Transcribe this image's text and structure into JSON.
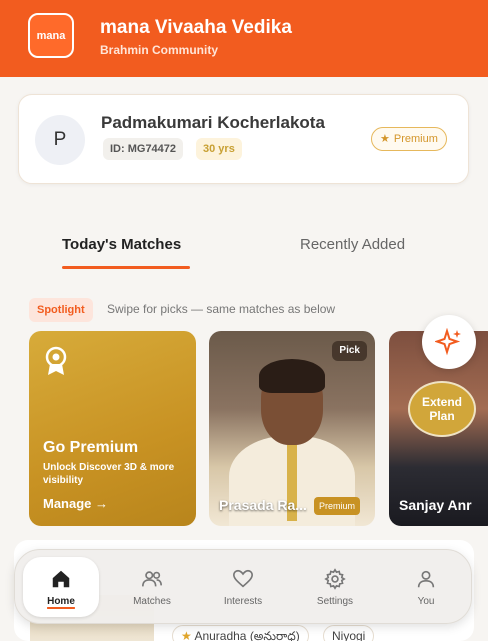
{
  "header": {
    "logo_text": "mana",
    "title": "mana Vivaaha Vedika",
    "subtitle": "Brahmin Community"
  },
  "profile": {
    "avatar_initial": "P",
    "name": "Padmakumari Kocherlakota",
    "id": "ID: MG74472",
    "age": "30 yrs",
    "badge": "Premium"
  },
  "tabs": {
    "today": "Today's Matches",
    "recent": "Recently Added"
  },
  "spotlight": {
    "tag": "Spotlight",
    "text": "Swipe for picks — same matches as below"
  },
  "premium_card": {
    "title": "Go Premium",
    "subtitle": "Unlock Discover 3D & more visibility",
    "action": "Manage"
  },
  "match_cards": [
    {
      "name": "Prasada Ra...",
      "tag": "Pick",
      "badge": "Premium"
    },
    {
      "name": "Sanjay Anr"
    }
  ],
  "fab": {
    "extend_line1": "Extend",
    "extend_line2": "Plan"
  },
  "below": {
    "chip_name": "Anuradha (అనురాధ)",
    "chip_community": "Niyogi"
  },
  "nav": {
    "items": [
      {
        "label": "Home",
        "icon": "home-icon"
      },
      {
        "label": "Matches",
        "icon": "users-icon"
      },
      {
        "label": "Interests",
        "icon": "heart-icon"
      },
      {
        "label": "Settings",
        "icon": "gear-icon"
      },
      {
        "label": "You",
        "icon": "person-icon"
      }
    ]
  },
  "colors": {
    "brand": "#f25c1f",
    "gold": "#c89223"
  }
}
